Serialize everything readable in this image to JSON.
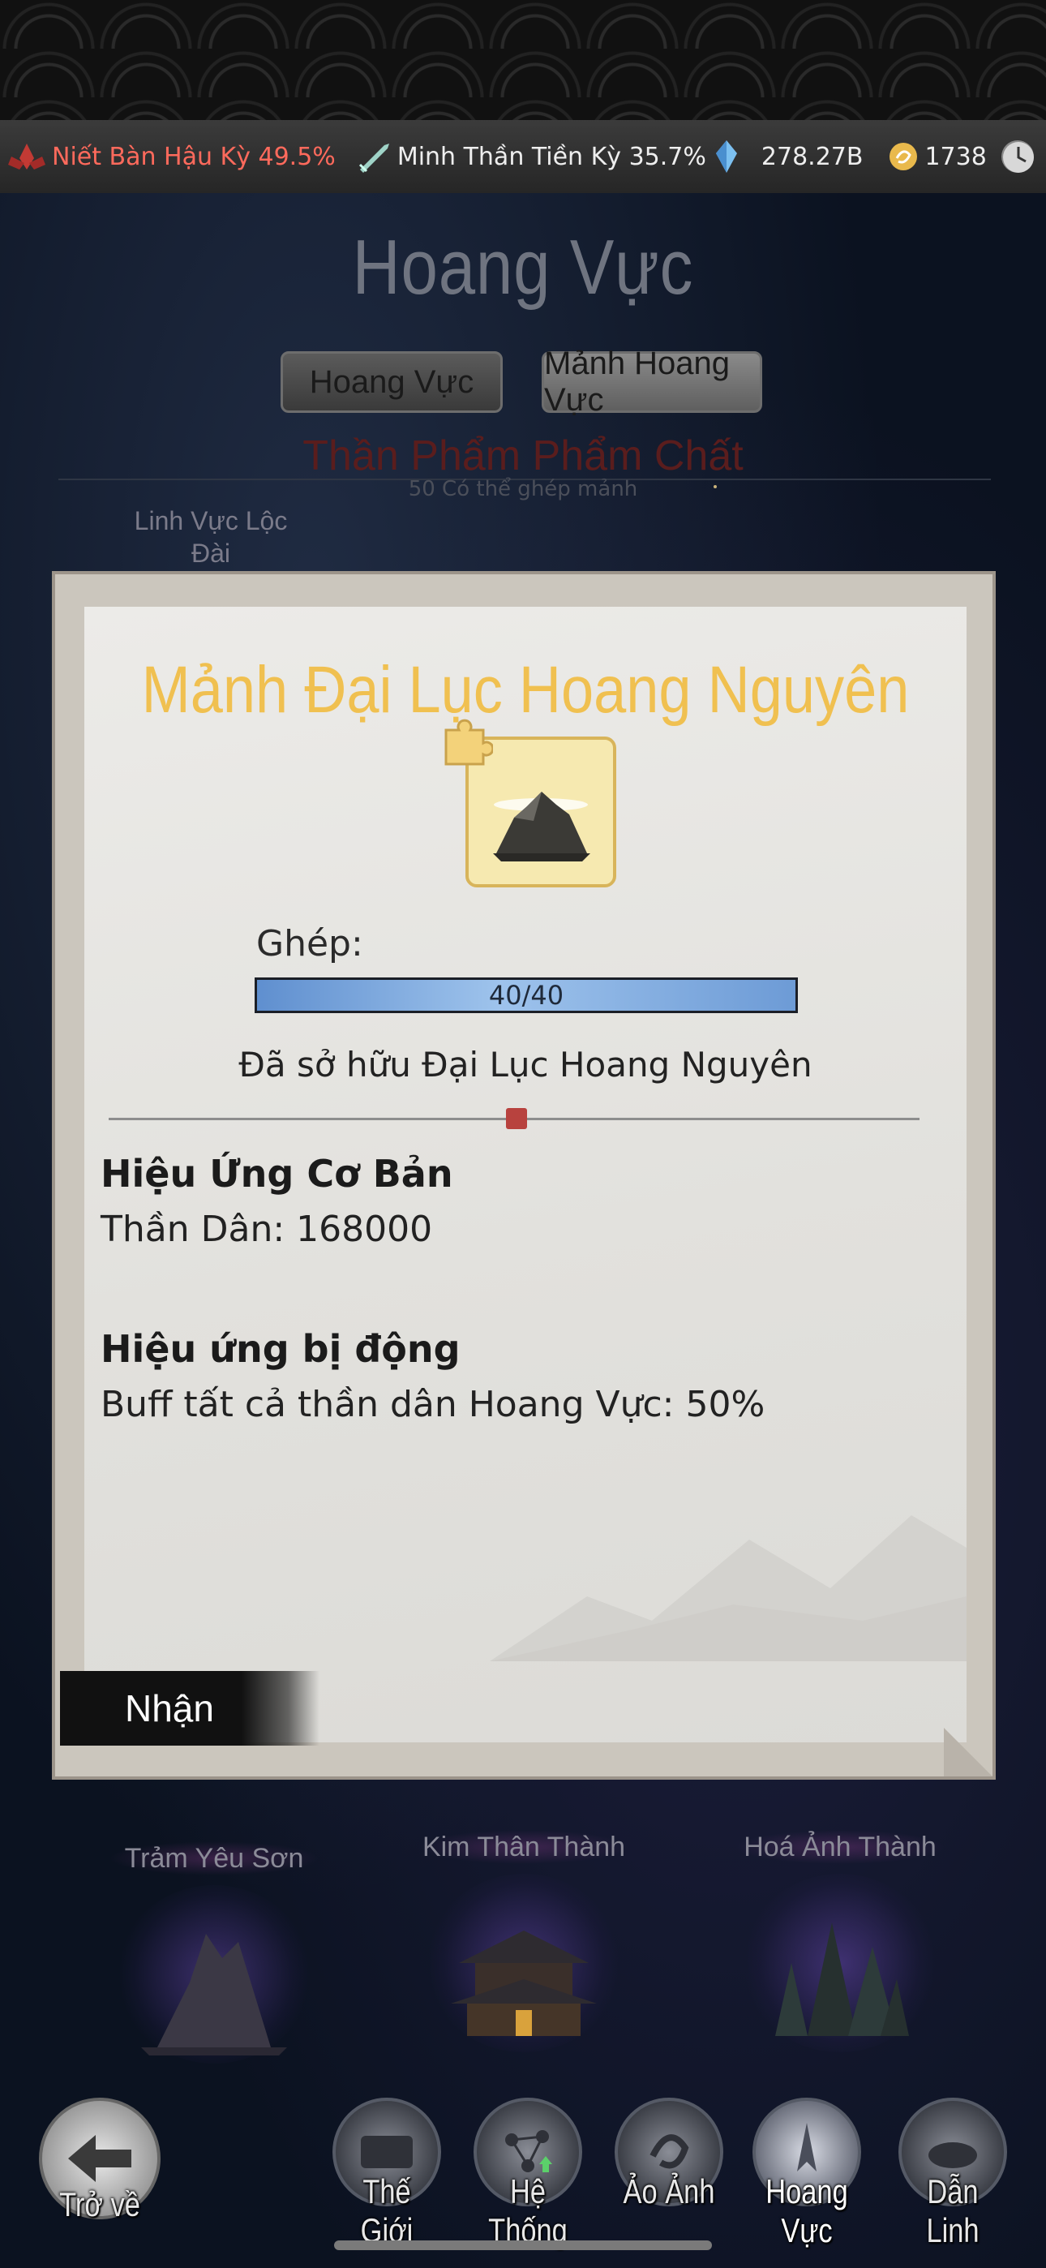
{
  "status_bar": {
    "resources": [
      {
        "icon": "lotus-icon",
        "label": "Niết Bàn Hậu Kỳ 49.5%",
        "color": "#ff6a5c"
      },
      {
        "icon": "sword-icon",
        "label": "Minh Thần Tiền Kỳ 35.7%"
      },
      {
        "icon": "crystal-icon",
        "label": "278.27B"
      },
      {
        "icon": "coin-icon",
        "label": "1738"
      }
    ],
    "plus_icon": "plus-icon",
    "clock_icon": "clock-icon"
  },
  "page": {
    "title": "Hoang Vực",
    "tabs": [
      "Hoang Vực",
      "Mảnh Hoang Vực"
    ],
    "tier_title": "Thần Phẩm Phẩm Chất",
    "tier_sub": "50 Có thể ghép mảnh",
    "region_tag": "Linh Vực Lộc Đài",
    "regions": [
      "Trảm Yêu Sơn",
      "Kim Thân Thành",
      "Hoá Ảnh Thành"
    ]
  },
  "card": {
    "title": "Mảnh Đại Lục Hoang Nguyên",
    "compose_label": "Ghép:",
    "progress_text": "40/40",
    "progress_fraction": 1.0,
    "owned_text": "Đã sở hữu Đại Lục Hoang Nguyên",
    "base_effect_title": "Hiệu Ứng Cơ Bản",
    "base_effect_value": "Thần Dân: 168000",
    "passive_title": "Hiệu ứng bị động",
    "passive_value": "Buff tất cả thần dân Hoang Vực: 50%",
    "claim_button": "Nhận"
  },
  "bottom_nav": {
    "back": "Trở về",
    "items": [
      "Thế Giới",
      "Hệ Thống",
      "Ảo Ảnh",
      "Hoang Vực",
      "Dẫn Linh"
    ],
    "active": "Hoang Vực"
  }
}
